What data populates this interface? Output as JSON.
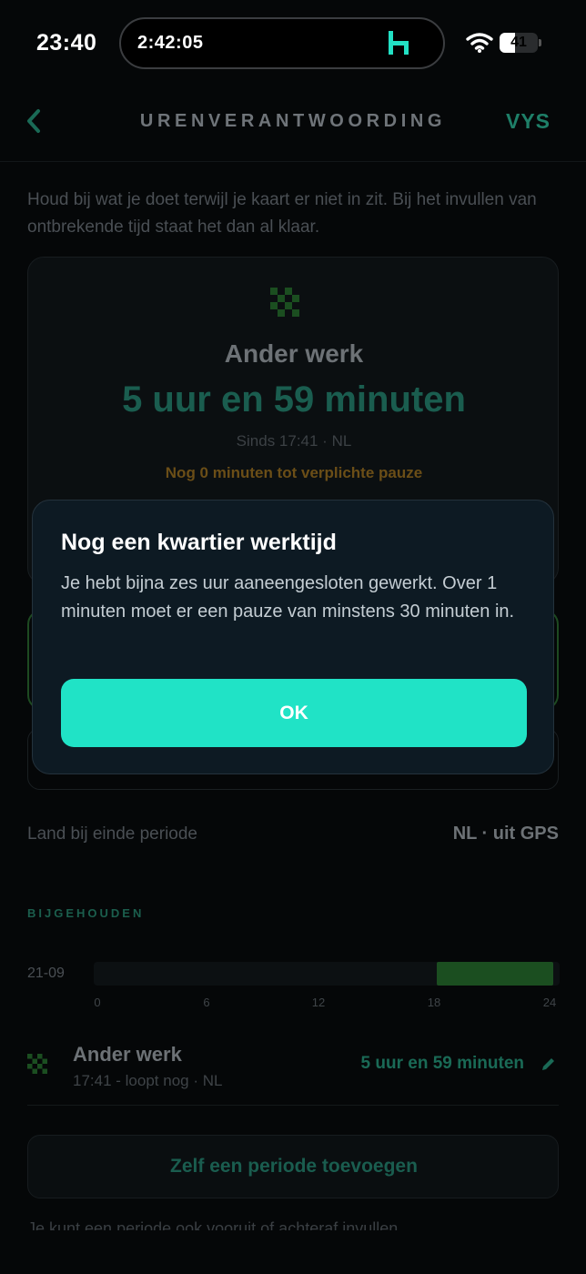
{
  "status_bar": {
    "time": "23:40",
    "live_activity_timer": "2:42:05",
    "battery_level": "41"
  },
  "nav": {
    "title": "URENVERANTWOORDING",
    "logo_text": "VYS"
  },
  "intro_text": "Houd bij wat je doet terwijl je kaart er niet in zit. Bij het invullen van ontbrekende tijd staat het dan al klaar.",
  "current_activity": {
    "title": "Ander werk",
    "duration": "5 uur en 59 minuten",
    "since": "Sinds 17:41 · NL",
    "pause_notice": "Nog 0 minuten tot verplichte pauze"
  },
  "country_end": {
    "label": "Land bij einde periode",
    "value": "NL · uit GPS"
  },
  "tracked": {
    "section_title": "BIJGEHOUDEN",
    "timeline": {
      "date": "21-09",
      "axis_min": 0,
      "axis_max": 24,
      "ticks": [
        "0",
        "6",
        "12",
        "18",
        "24"
      ],
      "segment_start_hour": 17.68,
      "segment_end_hour": 23.67
    },
    "entries": [
      {
        "title": "Ander werk",
        "subtitle": "17:41 - loopt nog · NL",
        "duration": "5 uur en 59 minuten"
      }
    ],
    "add_button_label": "Zelf een periode toevoegen",
    "footnote": "Je kunt een periode ook vooruit of achteraf invullen."
  },
  "modal": {
    "title": "Nog een kwartier werktijd",
    "body": "Je hebt bijna zes uur aaneengesloten gewerkt. Over 1 minuten moet er een pauze van minstens 30 minuten in.",
    "ok_label": "OK"
  },
  "colors": {
    "accent": "#20e3c6",
    "background": "#050708",
    "modal_background": "#0d1a23",
    "timeline_fill": "#1b4e20",
    "pause_warning": "#6b4e17"
  },
  "icons": {
    "back": "chevron-left-icon",
    "activity": "checker-icon",
    "edit": "pencil-icon",
    "wifi": "wifi-icon",
    "battery": "battery-icon",
    "live_activity_logo": "h-logo-icon"
  }
}
